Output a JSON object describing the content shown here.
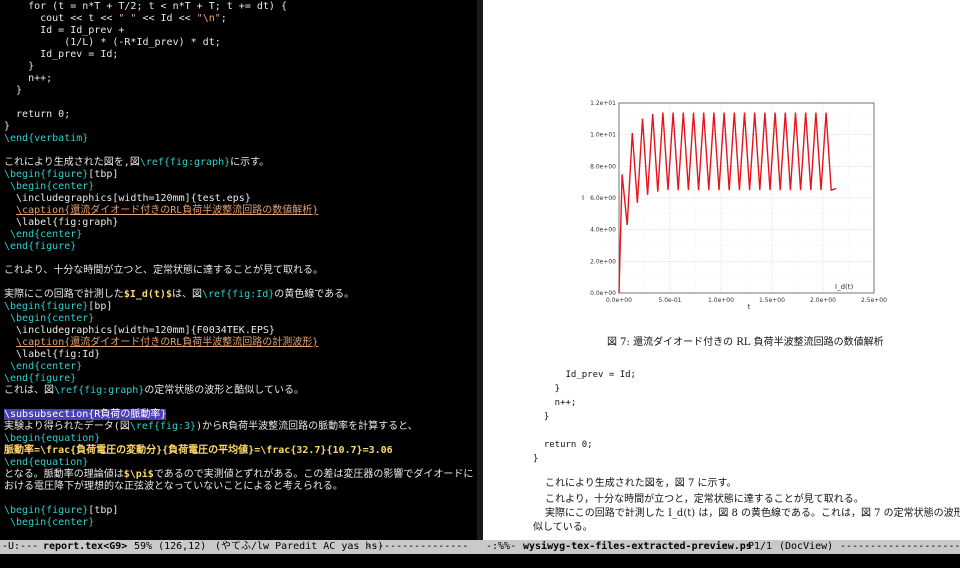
{
  "editor": {
    "lines": [
      {
        "segs": [
          {
            "t": "    for (t = n*T + T/2; t < n*T + T; t += dt) {",
            "c": ""
          }
        ]
      },
      {
        "segs": [
          {
            "t": "      cout << t << ",
            "c": ""
          },
          {
            "t": "\" \"",
            "c": "str"
          },
          {
            "t": " << Id << ",
            "c": ""
          },
          {
            "t": "\"\\n\"",
            "c": "str"
          },
          {
            "t": ";",
            "c": ""
          }
        ]
      },
      {
        "segs": [
          {
            "t": "      Id = Id_prev +",
            "c": ""
          }
        ]
      },
      {
        "segs": [
          {
            "t": "          (1/L) * (-R*Id_prev) * dt;",
            "c": ""
          }
        ]
      },
      {
        "segs": [
          {
            "t": "      Id_prev = Id;",
            "c": ""
          }
        ]
      },
      {
        "segs": [
          {
            "t": "    }",
            "c": ""
          }
        ]
      },
      {
        "segs": [
          {
            "t": "    n++;",
            "c": ""
          }
        ]
      },
      {
        "segs": [
          {
            "t": "  }",
            "c": ""
          }
        ]
      },
      {
        "segs": [
          {
            "t": "",
            "c": ""
          }
        ]
      },
      {
        "segs": [
          {
            "t": "  return 0;",
            "c": ""
          }
        ]
      },
      {
        "segs": [
          {
            "t": "}",
            "c": ""
          }
        ]
      },
      {
        "segs": [
          {
            "t": "\\end{verbatim}",
            "c": "kw"
          }
        ]
      },
      {
        "segs": [
          {
            "t": "",
            "c": ""
          }
        ]
      },
      {
        "segs": [
          {
            "t": "これにより生成された図を,図",
            "c": ""
          },
          {
            "t": "\\ref{fig:graph}",
            "c": "ref"
          },
          {
            "t": "に示す。",
            "c": ""
          }
        ]
      },
      {
        "segs": [
          {
            "t": "\\begin{figure}",
            "c": "kw"
          },
          {
            "t": "[tbp]",
            "c": ""
          }
        ]
      },
      {
        "segs": [
          {
            "t": " \\begin{center}",
            "c": "kw"
          }
        ]
      },
      {
        "segs": [
          {
            "t": "  \\includegraphics[width=120mm]{test.eps}",
            "c": ""
          }
        ]
      },
      {
        "segs": [
          {
            "t": "  ",
            "c": ""
          },
          {
            "t": "\\caption{還流ダイオード付きのRL負荷半波整流回路の数値解析}",
            "c": "cap"
          }
        ]
      },
      {
        "segs": [
          {
            "t": "  \\label{fig:graph}",
            "c": ""
          }
        ]
      },
      {
        "segs": [
          {
            "t": " \\end{center}",
            "c": "kw"
          }
        ]
      },
      {
        "segs": [
          {
            "t": "\\end{figure}",
            "c": "kw"
          }
        ]
      },
      {
        "segs": [
          {
            "t": "",
            "c": ""
          }
        ]
      },
      {
        "segs": [
          {
            "t": "これより、十分な時間が立つと、定常状態に達することが見て取れる。",
            "c": ""
          }
        ]
      },
      {
        "segs": [
          {
            "t": "",
            "c": ""
          }
        ]
      },
      {
        "segs": [
          {
            "t": "実際にこの回路で計測した",
            "c": ""
          },
          {
            "t": "$I_d(t)$",
            "c": "bold"
          },
          {
            "t": "は、図",
            "c": ""
          },
          {
            "t": "\\ref{fig:Id}",
            "c": "ref"
          },
          {
            "t": "の黄色線である。",
            "c": ""
          }
        ]
      },
      {
        "segs": [
          {
            "t": "\\begin{figure}",
            "c": "kw"
          },
          {
            "t": "[bp]",
            "c": ""
          }
        ]
      },
      {
        "segs": [
          {
            "t": " \\begin{center}",
            "c": "kw"
          }
        ]
      },
      {
        "segs": [
          {
            "t": "  \\includegraphics[width=120mm]{F0034TEK.EPS}",
            "c": ""
          }
        ]
      },
      {
        "segs": [
          {
            "t": "  ",
            "c": ""
          },
          {
            "t": "\\caption{還流ダイオード付きのRL負荷半波整流回路の計測波形}",
            "c": "cap"
          }
        ]
      },
      {
        "segs": [
          {
            "t": "  \\label{fig:Id}",
            "c": ""
          }
        ]
      },
      {
        "segs": [
          {
            "t": " \\end{center}",
            "c": "kw"
          }
        ]
      },
      {
        "segs": [
          {
            "t": "\\end{figure}",
            "c": "kw"
          }
        ]
      },
      {
        "segs": [
          {
            "t": "これは、図",
            "c": ""
          },
          {
            "t": "\\ref{fig:graph}",
            "c": "ref"
          },
          {
            "t": "の定常状態の波形と酷似している。",
            "c": ""
          }
        ]
      },
      {
        "segs": [
          {
            "t": "",
            "c": ""
          }
        ]
      },
      {
        "segs": [
          {
            "t": "\\subsubsection{R負荷の脈動率}",
            "c": "hl"
          }
        ]
      },
      {
        "segs": [
          {
            "t": "実験より得られたデータ(図",
            "c": ""
          },
          {
            "t": "\\ref{fig:3}",
            "c": "ref"
          },
          {
            "t": ")からR負荷半波整流回路の脈動率を計算すると、",
            "c": ""
          }
        ]
      },
      {
        "segs": [
          {
            "t": "\\begin{equation}",
            "c": "kw"
          }
        ]
      },
      {
        "segs": [
          {
            "t": "脈動率=\\frac{負荷電圧の変動分}{負荷電圧の平均値}=\\frac{32.7}{10.7}=3.06",
            "c": "bold"
          }
        ]
      },
      {
        "segs": [
          {
            "t": "\\end{equation}",
            "c": "kw"
          }
        ]
      },
      {
        "segs": [
          {
            "t": "となる。脈動率の理論値は",
            "c": ""
          },
          {
            "t": "$\\pi$",
            "c": "bold"
          },
          {
            "t": "であるので実測値とずれがある。この差は変圧器の影響でダイオードに",
            "c": ""
          }
        ]
      },
      {
        "segs": [
          {
            "t": "おける電圧降下が理想的な正弦波となっていないことによると考えられる。",
            "c": ""
          }
        ]
      },
      {
        "segs": [
          {
            "t": "",
            "c": ""
          }
        ]
      },
      {
        "segs": [
          {
            "t": "\\begin{figure}",
            "c": "kw"
          },
          {
            "t": "[tbp]",
            "c": ""
          }
        ]
      },
      {
        "segs": [
          {
            "t": " \\begin{center}",
            "c": "kw"
          }
        ]
      }
    ]
  },
  "modeline": {
    "left_status": "-U:---",
    "left_buffer": "report.tex<G9>",
    "left_position": "59% (126,12)",
    "left_modes": "(やてふ/lw Paredit AC yas hs)",
    "right_status": "-:%%-",
    "right_buffer": "wysiwyg-tex-files-extracted-preview.ps",
    "right_page": "P1/1",
    "right_modes": "(DocView)"
  },
  "document": {
    "figure_caption": "図 7: 還流ダイオード付きの RL 負荷半波整流回路の数値解析",
    "code_lines": [
      "      Id_prev = Id;",
      "    }",
      "    n++;",
      "  }",
      "",
      "  return 0;",
      "}"
    ],
    "body_lines": [
      "これにより生成された図を，図 7 に示す。",
      "これより，十分な時間が立つと，定常状態に達することが見て取れる。",
      "実際にこの回路で計測した I_d(t) は，図 8 の黄色線である。これは，図 7 の定常状態の波形と酷",
      "似している。"
    ]
  },
  "chart_data": {
    "type": "line",
    "title": "",
    "xlabel": "t",
    "ylabel": "I",
    "legend": "I_d(t)",
    "series_color": "#e8141c",
    "xlim": [
      0,
      2.5
    ],
    "ylim": [
      0,
      12
    ],
    "x_ticks": [
      "0.0e+00",
      "5.0e-01",
      "1.0e+00",
      "1.5e+00",
      "2.0e+00",
      "2.5e+00"
    ],
    "y_ticks": [
      "0.0e+00",
      "2.0e+00",
      "4.0e+00",
      "6.0e+00",
      "8.0e+00",
      "1.0e+01",
      "1.2e+01"
    ],
    "series": [
      {
        "name": "I_d(t)",
        "x": [
          0,
          0.03,
          0.08,
          0.13,
          0.18,
          0.23,
          0.28,
          0.33,
          0.38,
          0.43,
          0.48,
          0.53,
          0.58,
          0.63,
          0.68,
          0.73,
          0.78,
          0.83,
          0.88,
          0.93,
          0.98,
          1.03,
          1.08,
          1.13,
          1.18,
          1.23,
          1.28,
          1.33,
          1.38,
          1.43,
          1.48,
          1.53,
          1.58,
          1.63,
          1.68,
          1.73,
          1.78,
          1.83,
          1.88,
          1.93,
          1.98,
          2.03,
          2.08,
          2.13
        ],
        "y": [
          0,
          7.5,
          4.3,
          10.1,
          5.7,
          11.0,
          6.2,
          11.3,
          6.4,
          11.4,
          6.5,
          11.4,
          6.5,
          11.4,
          6.5,
          11.4,
          6.5,
          11.4,
          6.5,
          11.4,
          6.5,
          11.4,
          6.5,
          11.4,
          6.5,
          11.4,
          6.5,
          11.4,
          6.5,
          11.4,
          6.5,
          11.4,
          6.5,
          11.4,
          6.5,
          11.4,
          6.5,
          11.4,
          6.5,
          11.4,
          6.5,
          11.4,
          6.5,
          6.6
        ]
      }
    ]
  }
}
